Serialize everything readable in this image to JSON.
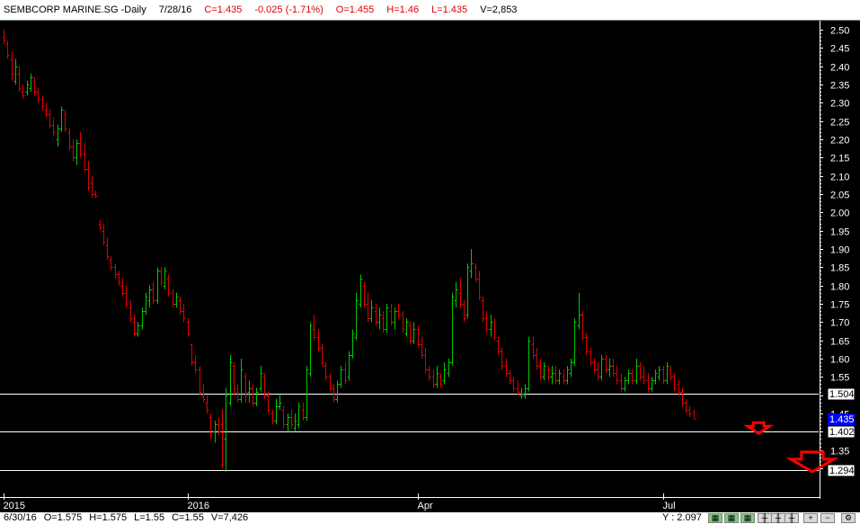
{
  "header": {
    "symbol": "SEMBCORP MARINE.SG -Daily",
    "date": "7/28/16",
    "close": "C=1.435",
    "change": "-0.025 (-1.71%)",
    "open": "O=1.455",
    "high": "H=1.46",
    "low": "L=1.435",
    "volume": "V=2,853"
  },
  "footer": {
    "date": "6/30/16",
    "open": "O=1.575",
    "high": "H=1.575",
    "low": "L=1.55",
    "close": "C=1.55",
    "volume": "V=7,426",
    "y_readout": "Y : 2.097"
  },
  "colors": {
    "up_bar": "#00c800",
    "down_bar": "#e00000",
    "background": "#000000",
    "grid_line": "#ffffff",
    "arrow": "#ff0000",
    "last_price_tag": "#0000ff"
  },
  "toolbar_icons": [
    "grid-icon",
    "grid-icon",
    "grid-icon",
    "bar-chart-icon",
    "bar-chart-icon",
    "bar-chart-icon",
    "zoom-in-icon",
    "zoom-out-icon",
    "settings-icon"
  ],
  "chart_data": {
    "type": "ohlc",
    "title": "SEMBCORP MARINE.SG -Daily",
    "ylim": [
      1.28,
      2.52
    ],
    "y_ticks": [
      "2.50",
      "2.45",
      "2.40",
      "2.35",
      "2.30",
      "2.25",
      "2.20",
      "2.15",
      "2.10",
      "2.05",
      "2.00",
      "1.95",
      "1.90",
      "1.85",
      "1.80",
      "1.75",
      "1.70",
      "1.65",
      "1.60",
      "1.55",
      "1.50",
      "1.45",
      "1.40",
      "1.35",
      "1.30"
    ],
    "x_ticks": [
      {
        "label": "2015",
        "index": 0
      },
      {
        "label": "2016",
        "index": 48
      },
      {
        "label": "Apr",
        "index": 108
      },
      {
        "label": "Jul",
        "index": 172
      }
    ],
    "horizontal_levels": [
      {
        "value": 1.504,
        "label": "1.504"
      },
      {
        "value": 1.402,
        "label": "1.402"
      },
      {
        "value": 1.294,
        "label": "1.294"
      }
    ],
    "last_price": {
      "value": 1.435,
      "label": "1.435"
    },
    "arrows": [
      {
        "index": 197,
        "value": 1.41,
        "size": "small"
      },
      {
        "index": 211,
        "value": 1.32,
        "size": "large"
      }
    ],
    "bars": [
      [
        0,
        2.48,
        2.5,
        2.46,
        2.47
      ],
      [
        1,
        2.46,
        2.47,
        2.42,
        2.43
      ],
      [
        2,
        2.42,
        2.44,
        2.36,
        2.38
      ],
      [
        3,
        2.36,
        2.42,
        2.35,
        2.4
      ],
      [
        4,
        2.38,
        2.4,
        2.33,
        2.34
      ],
      [
        5,
        2.33,
        2.35,
        2.31,
        2.32
      ],
      [
        6,
        2.33,
        2.36,
        2.32,
        2.35
      ],
      [
        7,
        2.34,
        2.38,
        2.33,
        2.37
      ],
      [
        8,
        2.36,
        2.37,
        2.32,
        2.33
      ],
      [
        9,
        2.33,
        2.34,
        2.3,
        2.31
      ],
      [
        10,
        2.31,
        2.32,
        2.28,
        2.29
      ],
      [
        11,
        2.28,
        2.3,
        2.26,
        2.27
      ],
      [
        12,
        2.27,
        2.28,
        2.23,
        2.24
      ],
      [
        13,
        2.24,
        2.26,
        2.21,
        2.22
      ],
      [
        14,
        2.2,
        2.24,
        2.18,
        2.23
      ],
      [
        15,
        2.23,
        2.29,
        2.22,
        2.28
      ],
      [
        16,
        2.27,
        2.28,
        2.22,
        2.23
      ],
      [
        17,
        2.22,
        2.23,
        2.17,
        2.18
      ],
      [
        18,
        2.18,
        2.2,
        2.14,
        2.15
      ],
      [
        19,
        2.15,
        2.2,
        2.13,
        2.19
      ],
      [
        20,
        2.19,
        2.22,
        2.15,
        2.16
      ],
      [
        21,
        2.16,
        2.19,
        2.11,
        2.12
      ],
      [
        22,
        2.12,
        2.14,
        2.06,
        2.07
      ],
      [
        23,
        2.08,
        2.1,
        2.04,
        2.05
      ],
      [
        24,
        2.05,
        2.06,
        2.04,
        2.045
      ],
      [
        25,
        1.97,
        1.98,
        1.95,
        1.96
      ],
      [
        26,
        1.95,
        1.97,
        1.91,
        1.92
      ],
      [
        27,
        1.91,
        1.93,
        1.87,
        1.88
      ],
      [
        28,
        1.87,
        1.88,
        1.84,
        1.85
      ],
      [
        29,
        1.85,
        1.86,
        1.82,
        1.83
      ],
      [
        30,
        1.83,
        1.84,
        1.8,
        1.81
      ],
      [
        31,
        1.8,
        1.82,
        1.77,
        1.78
      ],
      [
        32,
        1.78,
        1.8,
        1.74,
        1.75
      ],
      [
        33,
        1.74,
        1.76,
        1.7,
        1.71
      ],
      [
        34,
        1.7,
        1.72,
        1.66,
        1.67
      ],
      [
        35,
        1.67,
        1.7,
        1.66,
        1.69
      ],
      [
        36,
        1.69,
        1.74,
        1.68,
        1.73
      ],
      [
        37,
        1.73,
        1.78,
        1.72,
        1.77
      ],
      [
        38,
        1.76,
        1.8,
        1.74,
        1.79
      ],
      [
        39,
        1.79,
        1.81,
        1.75,
        1.76
      ],
      [
        40,
        1.76,
        1.85,
        1.75,
        1.84
      ],
      [
        41,
        1.84,
        1.85,
        1.8,
        1.81
      ],
      [
        42,
        1.8,
        1.85,
        1.79,
        1.84
      ],
      [
        43,
        1.82,
        1.83,
        1.77,
        1.78
      ],
      [
        44,
        1.78,
        1.79,
        1.74,
        1.75
      ],
      [
        45,
        1.75,
        1.78,
        1.74,
        1.77
      ],
      [
        46,
        1.76,
        1.77,
        1.72,
        1.73
      ],
      [
        47,
        1.73,
        1.75,
        1.7,
        1.71
      ],
      [
        48,
        1.7,
        1.71,
        1.66,
        1.67
      ],
      [
        49,
        1.64,
        1.64,
        1.58,
        1.59
      ],
      [
        50,
        1.59,
        1.61,
        1.56,
        1.57
      ],
      [
        51,
        1.57,
        1.58,
        1.5,
        1.51
      ],
      [
        52,
        1.5,
        1.53,
        1.48,
        1.49
      ],
      [
        53,
        1.48,
        1.5,
        1.45,
        1.46
      ],
      [
        54,
        1.44,
        1.45,
        1.38,
        1.39
      ],
      [
        55,
        1.4,
        1.43,
        1.37,
        1.42
      ],
      [
        56,
        1.42,
        1.44,
        1.39,
        1.4
      ],
      [
        57,
        1.42,
        1.46,
        1.3,
        1.31
      ],
      [
        58,
        1.38,
        1.52,
        1.29,
        1.5
      ],
      [
        59,
        1.48,
        1.61,
        1.47,
        1.59
      ],
      [
        60,
        1.58,
        1.59,
        1.5,
        1.52
      ],
      [
        61,
        1.51,
        1.53,
        1.48,
        1.49
      ],
      [
        62,
        1.49,
        1.6,
        1.48,
        1.57
      ],
      [
        63,
        1.55,
        1.56,
        1.48,
        1.5
      ],
      [
        64,
        1.51,
        1.54,
        1.48,
        1.52
      ],
      [
        65,
        1.52,
        1.53,
        1.47,
        1.48
      ],
      [
        66,
        1.48,
        1.52,
        1.47,
        1.51
      ],
      [
        67,
        1.52,
        1.58,
        1.51,
        1.56
      ],
      [
        68,
        1.55,
        1.56,
        1.49,
        1.5
      ],
      [
        69,
        1.5,
        1.51,
        1.45,
        1.46
      ],
      [
        70,
        1.45,
        1.46,
        1.42,
        1.43
      ],
      [
        71,
        1.43,
        1.49,
        1.42,
        1.47
      ],
      [
        72,
        1.47,
        1.5,
        1.46,
        1.48
      ],
      [
        73,
        1.46,
        1.47,
        1.41,
        1.42
      ],
      [
        74,
        1.42,
        1.45,
        1.4,
        1.44
      ],
      [
        75,
        1.44,
        1.46,
        1.41,
        1.42
      ],
      [
        76,
        1.41,
        1.45,
        1.4,
        1.43
      ],
      [
        77,
        1.42,
        1.48,
        1.41,
        1.47
      ],
      [
        78,
        1.46,
        1.48,
        1.43,
        1.44
      ],
      [
        79,
        1.44,
        1.58,
        1.43,
        1.57
      ],
      [
        80,
        1.56,
        1.7,
        1.55,
        1.69
      ],
      [
        81,
        1.68,
        1.72,
        1.65,
        1.66
      ],
      [
        82,
        1.66,
        1.68,
        1.62,
        1.63
      ],
      [
        83,
        1.63,
        1.64,
        1.58,
        1.59
      ],
      [
        84,
        1.58,
        1.59,
        1.54,
        1.55
      ],
      [
        85,
        1.55,
        1.56,
        1.51,
        1.52
      ],
      [
        86,
        1.52,
        1.53,
        1.48,
        1.49
      ],
      [
        87,
        1.49,
        1.54,
        1.48,
        1.53
      ],
      [
        88,
        1.53,
        1.58,
        1.52,
        1.57
      ],
      [
        89,
        1.57,
        1.59,
        1.53,
        1.54
      ],
      [
        90,
        1.55,
        1.62,
        1.54,
        1.61
      ],
      [
        91,
        1.61,
        1.68,
        1.6,
        1.67
      ],
      [
        92,
        1.66,
        1.78,
        1.65,
        1.76
      ],
      [
        93,
        1.75,
        1.83,
        1.74,
        1.82
      ],
      [
        94,
        1.8,
        1.81,
        1.74,
        1.75
      ],
      [
        95,
        1.75,
        1.78,
        1.7,
        1.71
      ],
      [
        96,
        1.71,
        1.76,
        1.7,
        1.74
      ],
      [
        97,
        1.73,
        1.75,
        1.69,
        1.7
      ],
      [
        98,
        1.7,
        1.74,
        1.68,
        1.72
      ],
      [
        99,
        1.71,
        1.73,
        1.67,
        1.68
      ],
      [
        100,
        1.68,
        1.75,
        1.67,
        1.74
      ],
      [
        101,
        1.73,
        1.75,
        1.69,
        1.7
      ],
      [
        102,
        1.7,
        1.74,
        1.68,
        1.73
      ],
      [
        103,
        1.73,
        1.75,
        1.71,
        1.72
      ],
      [
        104,
        1.72,
        1.73,
        1.67,
        1.68
      ],
      [
        105,
        1.67,
        1.71,
        1.66,
        1.7
      ],
      [
        106,
        1.69,
        1.7,
        1.64,
        1.65
      ],
      [
        107,
        1.65,
        1.7,
        1.64,
        1.68
      ],
      [
        108,
        1.68,
        1.69,
        1.63,
        1.64
      ],
      [
        109,
        1.64,
        1.66,
        1.6,
        1.61
      ],
      [
        110,
        1.61,
        1.63,
        1.56,
        1.57
      ],
      [
        111,
        1.57,
        1.58,
        1.54,
        1.55
      ],
      [
        112,
        1.55,
        1.57,
        1.52,
        1.53
      ],
      [
        113,
        1.53,
        1.58,
        1.52,
        1.56
      ],
      [
        114,
        1.55,
        1.56,
        1.52,
        1.53
      ],
      [
        115,
        1.54,
        1.59,
        1.53,
        1.57
      ],
      [
        116,
        1.56,
        1.6,
        1.55,
        1.59
      ],
      [
        117,
        1.59,
        1.78,
        1.58,
        1.77
      ],
      [
        118,
        1.76,
        1.81,
        1.74,
        1.79
      ],
      [
        119,
        1.78,
        1.82,
        1.74,
        1.75
      ],
      [
        120,
        1.75,
        1.76,
        1.7,
        1.71
      ],
      [
        121,
        1.72,
        1.86,
        1.71,
        1.85
      ],
      [
        122,
        1.84,
        1.9,
        1.82,
        1.86
      ],
      [
        123,
        1.85,
        1.86,
        1.81,
        1.82
      ],
      [
        124,
        1.82,
        1.84,
        1.76,
        1.77
      ],
      [
        125,
        1.76,
        1.77,
        1.7,
        1.71
      ],
      [
        126,
        1.71,
        1.73,
        1.67,
        1.68
      ],
      [
        127,
        1.68,
        1.72,
        1.66,
        1.7
      ],
      [
        128,
        1.69,
        1.71,
        1.65,
        1.66
      ],
      [
        129,
        1.65,
        1.66,
        1.61,
        1.62
      ],
      [
        130,
        1.62,
        1.63,
        1.57,
        1.58
      ],
      [
        131,
        1.58,
        1.6,
        1.55,
        1.56
      ],
      [
        132,
        1.56,
        1.57,
        1.53,
        1.54
      ],
      [
        133,
        1.54,
        1.55,
        1.51,
        1.52
      ],
      [
        134,
        1.52,
        1.54,
        1.5,
        1.51
      ],
      [
        135,
        1.5,
        1.52,
        1.49,
        1.505
      ],
      [
        136,
        1.5,
        1.53,
        1.49,
        1.52
      ],
      [
        137,
        1.52,
        1.66,
        1.51,
        1.65
      ],
      [
        138,
        1.64,
        1.66,
        1.6,
        1.61
      ],
      [
        139,
        1.61,
        1.63,
        1.57,
        1.58
      ],
      [
        140,
        1.58,
        1.6,
        1.54,
        1.55
      ],
      [
        141,
        1.55,
        1.59,
        1.54,
        1.58
      ],
      [
        142,
        1.57,
        1.58,
        1.54,
        1.55
      ],
      [
        143,
        1.55,
        1.58,
        1.53,
        1.56
      ],
      [
        144,
        1.56,
        1.58,
        1.53,
        1.54
      ],
      [
        145,
        1.54,
        1.57,
        1.53,
        1.56
      ],
      [
        146,
        1.55,
        1.57,
        1.53,
        1.54
      ],
      [
        147,
        1.54,
        1.58,
        1.53,
        1.57
      ],
      [
        148,
        1.56,
        1.6,
        1.55,
        1.59
      ],
      [
        149,
        1.59,
        1.71,
        1.58,
        1.7
      ],
      [
        150,
        1.69,
        1.78,
        1.68,
        1.72
      ],
      [
        151,
        1.72,
        1.73,
        1.65,
        1.66
      ],
      [
        152,
        1.66,
        1.67,
        1.61,
        1.62
      ],
      [
        153,
        1.62,
        1.63,
        1.58,
        1.59
      ],
      [
        154,
        1.59,
        1.6,
        1.56,
        1.57
      ],
      [
        155,
        1.57,
        1.59,
        1.54,
        1.55
      ],
      [
        156,
        1.55,
        1.61,
        1.54,
        1.6
      ],
      [
        157,
        1.6,
        1.61,
        1.56,
        1.57
      ],
      [
        158,
        1.57,
        1.6,
        1.55,
        1.58
      ],
      [
        159,
        1.58,
        1.6,
        1.55,
        1.56
      ],
      [
        160,
        1.56,
        1.58,
        1.53,
        1.54
      ],
      [
        161,
        1.54,
        1.56,
        1.51,
        1.52
      ],
      [
        162,
        1.52,
        1.55,
        1.51,
        1.54
      ],
      [
        163,
        1.54,
        1.57,
        1.53,
        1.56
      ],
      [
        164,
        1.56,
        1.57,
        1.53,
        1.54
      ],
      [
        165,
        1.54,
        1.6,
        1.53,
        1.58
      ],
      [
        166,
        1.58,
        1.59,
        1.54,
        1.55
      ],
      [
        167,
        1.55,
        1.58,
        1.53,
        1.54
      ],
      [
        168,
        1.54,
        1.56,
        1.51,
        1.52
      ],
      [
        169,
        1.52,
        1.55,
        1.51,
        1.54
      ],
      [
        170,
        1.54,
        1.57,
        1.53,
        1.56
      ],
      [
        171,
        1.55,
        1.58,
        1.54,
        1.57
      ],
      [
        172,
        1.57,
        1.58,
        1.53,
        1.54
      ],
      [
        173,
        1.54,
        1.59,
        1.53,
        1.58
      ],
      [
        174,
        1.57,
        1.58,
        1.54,
        1.55
      ],
      [
        175,
        1.55,
        1.56,
        1.51,
        1.52
      ],
      [
        176,
        1.53,
        1.54,
        1.5,
        1.51
      ],
      [
        177,
        1.51,
        1.52,
        1.47,
        1.48
      ],
      [
        178,
        1.48,
        1.49,
        1.45,
        1.46
      ],
      [
        179,
        1.46,
        1.47,
        1.44,
        1.45
      ],
      [
        180,
        1.455,
        1.46,
        1.435,
        1.435
      ]
    ]
  }
}
